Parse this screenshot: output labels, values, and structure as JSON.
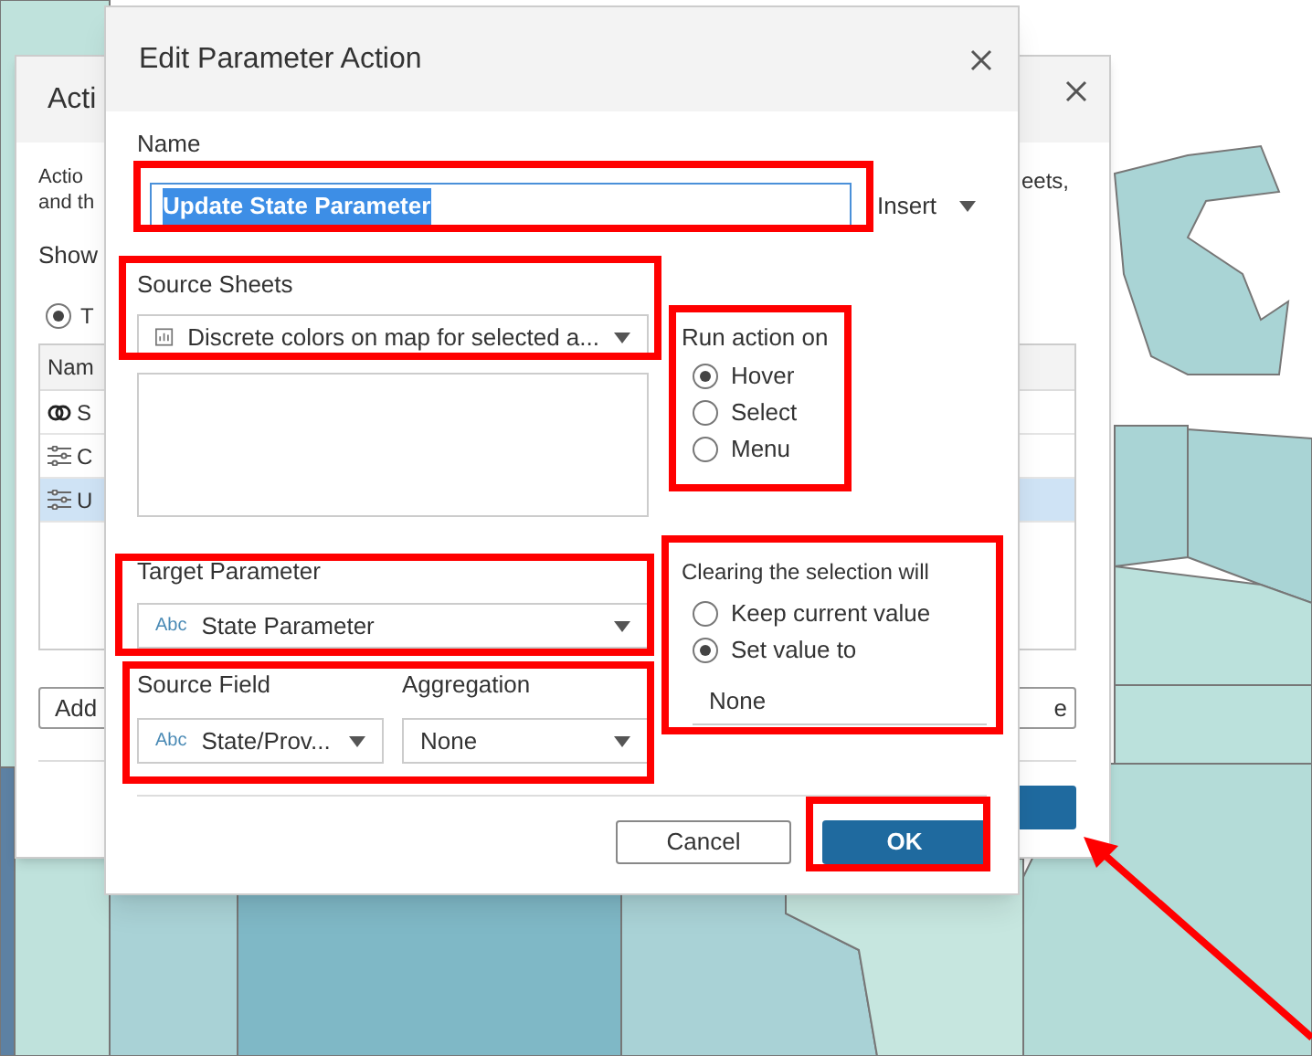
{
  "background_dialog": {
    "title": "Acti",
    "description_lines": [
      "Actio",
      "and th"
    ],
    "description_end": "eets,",
    "show_label": "Show",
    "show_option": {
      "label": "T",
      "selected": true
    },
    "table": {
      "header": "Nam",
      "rows": [
        {
          "kind": "link",
          "label": "S",
          "selected": false
        },
        {
          "kind": "parameter",
          "label": "C",
          "selected": false
        },
        {
          "kind": "parameter",
          "label": "U",
          "selected": true
        }
      ]
    },
    "add_button": "Add",
    "right_button": "e"
  },
  "dialog": {
    "title": "Edit Parameter Action",
    "name_label": "Name",
    "name_value": "Update State Parameter",
    "insert_menu": "Insert",
    "source_sheets": {
      "label": "Source Sheets",
      "value": "Discrete colors on map for selected a..."
    },
    "run_action_on": {
      "label": "Run action on",
      "options": [
        {
          "label": "Hover",
          "selected": true
        },
        {
          "label": "Select",
          "selected": false
        },
        {
          "label": "Menu",
          "selected": false
        }
      ]
    },
    "target_parameter": {
      "label": "Target Parameter",
      "type_badge": "Abc",
      "value": "State Parameter"
    },
    "source_field": {
      "label": "Source Field",
      "type_badge": "Abc",
      "value": "State/Prov..."
    },
    "aggregation": {
      "label": "Aggregation",
      "value": "None"
    },
    "clearing": {
      "label": "Clearing the selection will",
      "options": [
        {
          "label": "Keep current value",
          "selected": false
        },
        {
          "label": "Set value to",
          "selected": true
        }
      ],
      "value": "None"
    },
    "buttons": [
      {
        "label": "Cancel",
        "kind": "secondary"
      },
      {
        "label": "OK",
        "kind": "primary"
      }
    ]
  }
}
